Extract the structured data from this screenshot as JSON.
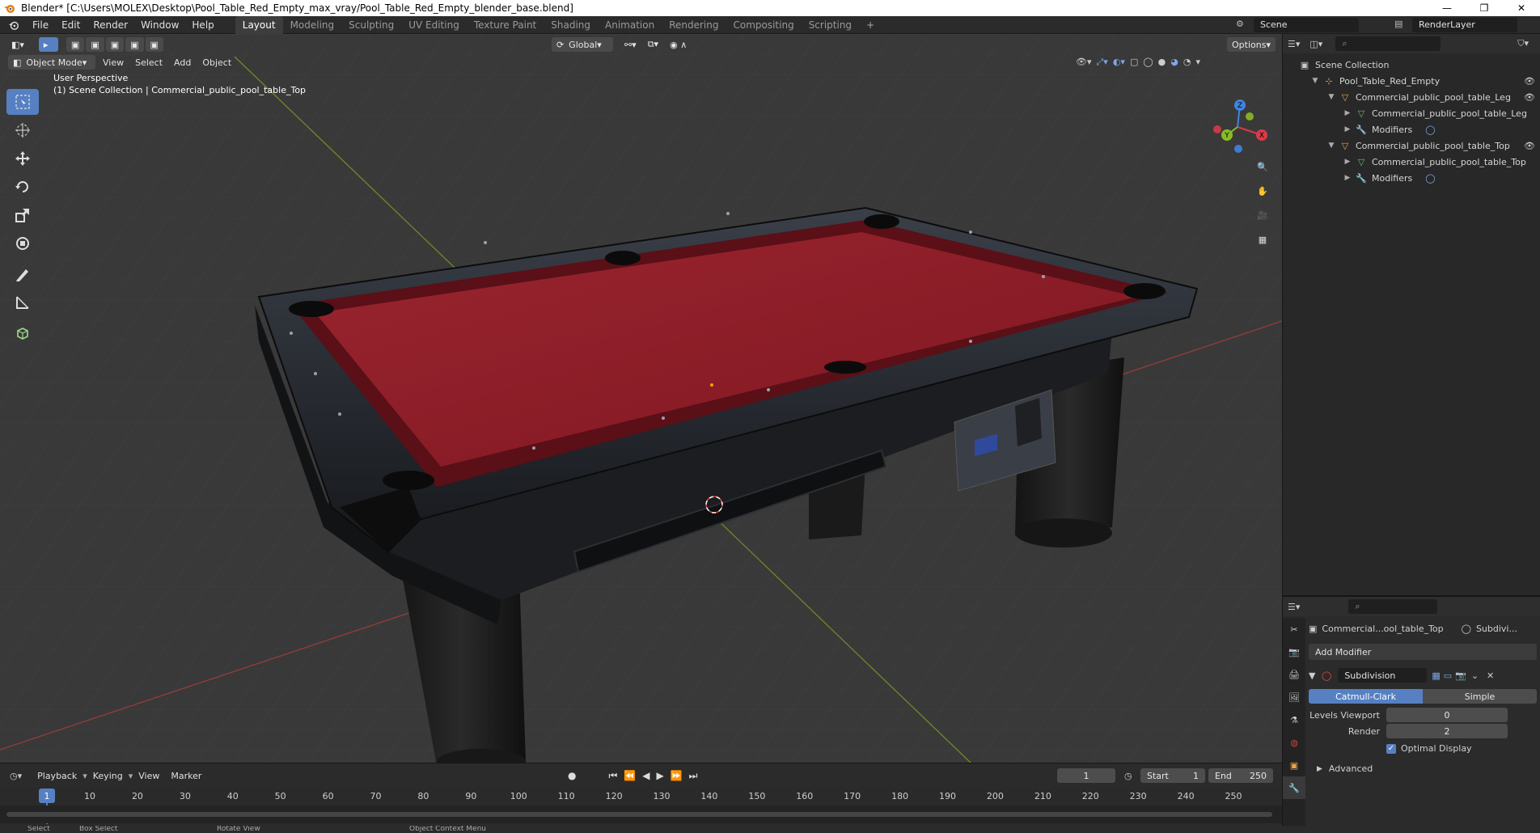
{
  "window": {
    "title": "Blender* [C:\\Users\\MOLEX\\Desktop\\Pool_Table_Red_Empty_max_vray/Pool_Table_Red_Empty_blender_base.blend]"
  },
  "menus": [
    "File",
    "Edit",
    "Render",
    "Window",
    "Help"
  ],
  "workspaces": [
    "Layout",
    "Modeling",
    "Sculpting",
    "UV Editing",
    "Texture Paint",
    "Shading",
    "Animation",
    "Rendering",
    "Compositing",
    "Scripting"
  ],
  "active_workspace": "Layout",
  "scene": {
    "name": "Scene",
    "render_layer": "RenderLayer"
  },
  "viewport": {
    "mode": "Object Mode",
    "menus": [
      "View",
      "Select",
      "Add",
      "Object"
    ],
    "orientation": "Global",
    "options_label": "Options",
    "perspective": "User Perspective",
    "collection_info": "(1) Scene Collection | Commercial_public_pool_table_Top",
    "felt_color": "#8e1a25",
    "gizmo_axes": {
      "x": "X",
      "y": "Y",
      "z": "Z"
    }
  },
  "outliner": {
    "root": "Scene Collection",
    "items": [
      {
        "label": "Pool_Table_Red_Empty",
        "depth": 1
      },
      {
        "label": "Commercial_public_pool_table_Leg",
        "depth": 2
      },
      {
        "label": "Commercial_public_pool_table_Leg",
        "depth": 3
      },
      {
        "label": "Modifiers",
        "depth": 3
      },
      {
        "label": "Commercial_public_pool_table_Top",
        "depth": 2
      },
      {
        "label": "Commercial_public_pool_table_Top",
        "depth": 3
      },
      {
        "label": "Modifiers",
        "depth": 3
      }
    ]
  },
  "properties": {
    "object_name": "Commercial...ool_table_Top",
    "modifier_short": "Subdivi...",
    "add_modifier": "Add Modifier",
    "modifier": {
      "name": "Subdivision",
      "types": [
        "Catmull-Clark",
        "Simple"
      ],
      "active_type": "Catmull-Clark",
      "levels_viewport_label": "Levels Viewport",
      "levels_viewport": "0",
      "render_label": "Render",
      "render": "2",
      "optimal_display_label": "Optimal Display",
      "optimal_display": true,
      "advanced_label": "Advanced"
    }
  },
  "timeline": {
    "menus": [
      "Playback",
      "Keying",
      "View",
      "Marker"
    ],
    "current_frame": "1",
    "start_label": "Start",
    "start": "1",
    "end_label": "End",
    "end": "250",
    "ticks": [
      "1",
      "10",
      "20",
      "30",
      "40",
      "50",
      "60",
      "70",
      "80",
      "90",
      "100",
      "110",
      "120",
      "130",
      "140",
      "150",
      "160",
      "170",
      "180",
      "190",
      "200",
      "210",
      "220",
      "230",
      "240",
      "250"
    ],
    "accent": "#5680c2"
  },
  "statusbar": {
    "items": [
      "Select",
      "Box Select",
      "Rotate View",
      "Object Context Menu"
    ]
  }
}
